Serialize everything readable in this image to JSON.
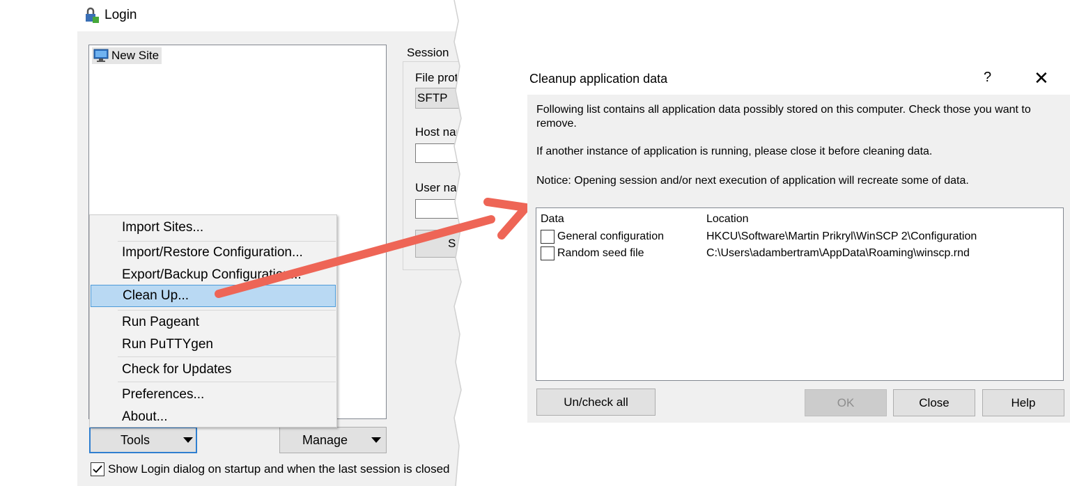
{
  "login": {
    "title": "Login",
    "site_tree": {
      "items": [
        {
          "label": "New Site"
        }
      ]
    },
    "session": {
      "group_label": "Session",
      "protocol_label": "File prot",
      "protocol_value": "SFTP",
      "host_label": "Host nan",
      "user_label": "User nar",
      "login_button_label": "S"
    },
    "tools_button": "Tools",
    "manage_button": "Manage",
    "startup_checkbox": {
      "label": "Show Login dialog on startup and when the last session is closed",
      "checked": true
    }
  },
  "tools_menu": {
    "items": [
      {
        "label": "Import Sites..."
      },
      {
        "label": "Import/Restore Configuration..."
      },
      {
        "label": "Export/Backup Configuration..."
      },
      {
        "label": "Clean Up...",
        "highlighted": true
      },
      {
        "label": "Run Pageant"
      },
      {
        "label": "Run PuTTYgen"
      },
      {
        "label": "Check for Updates"
      },
      {
        "label": "Preferences..."
      },
      {
        "label": "About..."
      }
    ]
  },
  "cleanup_dialog": {
    "title": "Cleanup application data",
    "help_glyph": "?",
    "close_glyph": "✕",
    "description": "Following list contains all application data possibly stored on this computer. Check those you want to remove.",
    "warning": "If another instance of application is running, please close it before cleaning data.",
    "notice": "Notice: Opening session and/or next execution of application will recreate some of data.",
    "columns": {
      "data": "Data",
      "location": "Location"
    },
    "rows": [
      {
        "data": "General configuration",
        "location": "HKCU\\Software\\Martin Prikryl\\WinSCP 2\\Configuration",
        "checked": false
      },
      {
        "data": "Random seed file",
        "location": "C:\\Users\\adambertram\\AppData\\Roaming\\winscp.rnd",
        "checked": false
      }
    ],
    "buttons": {
      "uncheck_all": "Un/check all",
      "ok": "OK",
      "close": "Close",
      "help": "Help"
    }
  },
  "colors": {
    "annotation_arrow": "#ee6556",
    "menu_highlight": "#b9d9f3",
    "focus_border": "#2f7fd0"
  }
}
